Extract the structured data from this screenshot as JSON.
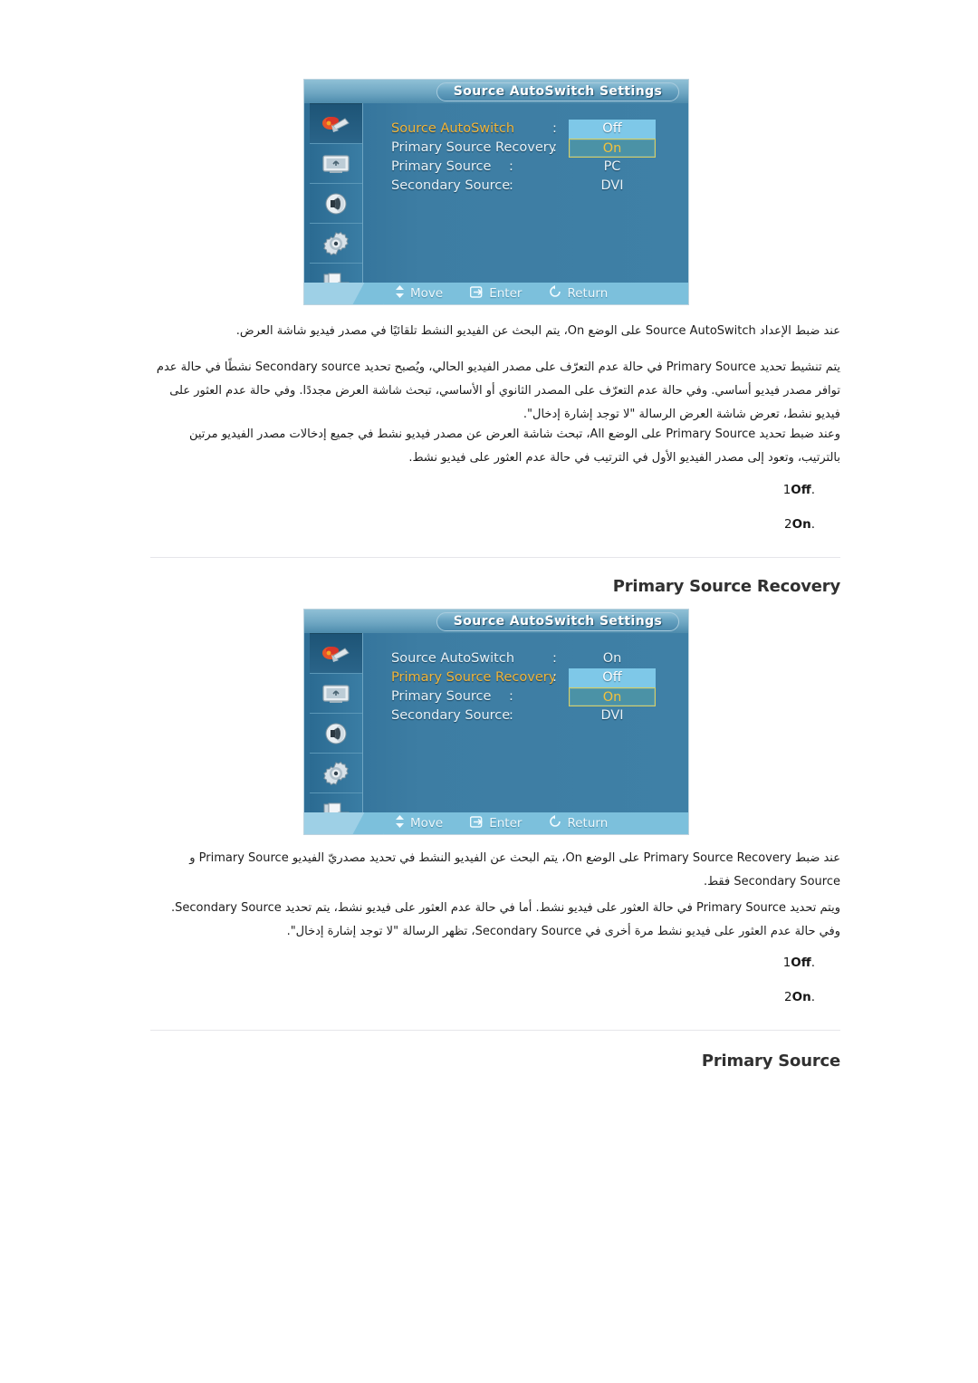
{
  "osd": {
    "title": "Source AutoSwitch Settings",
    "rail_icons": [
      "picture-brush-icon",
      "screen-display-icon",
      "speaker-sound-icon",
      "gear-setup-icon",
      "multi-control-pages-icon"
    ],
    "hints": [
      {
        "icon": "updown-arrow-icon",
        "label": "Move"
      },
      {
        "icon": "enter-key-icon",
        "label": "Enter"
      },
      {
        "icon": "return-arrow-icon",
        "label": "Return"
      }
    ],
    "colon": ":",
    "panel_one": {
      "rows": [
        {
          "label": "Source AutoSwitch",
          "value": "",
          "selected": true
        },
        {
          "label": "Primary Source Recovery",
          "value": "",
          "selected": false
        },
        {
          "label": "Primary Source",
          "value": "PC",
          "selected": false
        },
        {
          "label": "Secondary Source",
          "value": "DVI",
          "selected": false
        }
      ],
      "chips": [
        {
          "text": "Off",
          "style": "plain"
        },
        {
          "text": "On",
          "style": "boxed"
        }
      ]
    },
    "panel_two": {
      "rows": [
        {
          "label": "Source AutoSwitch",
          "value": "On",
          "selected": false
        },
        {
          "label": "Primary Source Recovery",
          "value": "",
          "selected": true
        },
        {
          "label": "Primary Source",
          "value": "",
          "selected": false
        },
        {
          "label": "Secondary Source",
          "value": "DVI",
          "selected": false
        }
      ],
      "chips": [
        {
          "text": "Off",
          "style": "plain"
        },
        {
          "text": "On",
          "style": "boxed"
        }
      ]
    }
  },
  "body": {
    "para_1": "عند ضبط الإعداد Source AutoSwitch على الوضع On، يتم البحث عن الفيديو النشط تلقائيًا في مصدر فيديو شاشة العرض.",
    "para_2": "يتم تنشيط تحديد Primary Source في حالة عدم التعرّف على مصدر الفيديو الحالي، ويُصبح تحديد Secondary source نشطًا في حالة عدم توافر مصدر فيديو أساسي. وفي حالة عدم التعرّف على المصدر الثانوي أو الأساسي، تبحث شاشة العرض مجددًا. وفي حالة عدم العثور على فيديو نشط، تعرض شاشة العرض الرسالة \"لا توجد إشارة إدخال\".",
    "para_3": "وعند ضبط تحديد Primary Source على الوضع All، تبحث شاشة العرض عن مصدر فيديو نشط في جميع إدخالات مصدر الفيديو مرتين بالترتيب، وتعود إلى مصدر الفيديو الأول في الترتيب في حالة عدم العثور على فيديو نشط.",
    "para_4": "عند ضبط Primary Source Recovery على الوضع On، يتم البحث عن الفيديو النشط في تحديد مصدريّ الفيديو Primary Source و Secondary Source فقط.",
    "para_5": "ويتم تحديد Primary Source في حالة العثور على فيديو نشط. أما في حالة عدم العثور على فيديو نشط، يتم تحديد Secondary Source. وفي حالة عدم العثور على فيديو نشط مرة أخرى في Secondary Source، تظهر الرسالة \"لا توجد إشارة إدخال\".",
    "list_one": [
      {
        "num": ".1",
        "text": "Off"
      },
      {
        "num": ".2",
        "text": "On"
      }
    ],
    "list_two": [
      {
        "num": ".1",
        "text": "Off"
      },
      {
        "num": ".2",
        "text": "On"
      }
    ],
    "heading_recovery": "Primary Source Recovery",
    "heading_primary": "Primary Source"
  }
}
